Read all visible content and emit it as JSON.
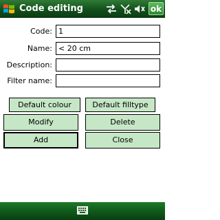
{
  "titlebar": {
    "title": "Code editing",
    "ok_label": "ok",
    "icons": [
      "windows-start-icon",
      "sync-icon",
      "no-signal-icon",
      "volume-icon"
    ]
  },
  "form": {
    "code": {
      "label": "Code:",
      "value": "1"
    },
    "name": {
      "label": "Name:",
      "value": "< 20 cm"
    },
    "description": {
      "label": "Description:",
      "value": ""
    },
    "filter_name": {
      "label": "Filter name:",
      "value": ""
    }
  },
  "buttons": {
    "default_colour": "Default colour",
    "default_filltype": "Default filltype",
    "modify": "Modify",
    "delete": "Delete",
    "add": "Add",
    "close": "Close"
  },
  "bottombar": {
    "icons": [
      "keyboard-icon"
    ]
  },
  "colors": {
    "titlebar_green": "#124f1b",
    "button_fill": "#c6e7c6",
    "ok_button": "#2c8a2f"
  }
}
